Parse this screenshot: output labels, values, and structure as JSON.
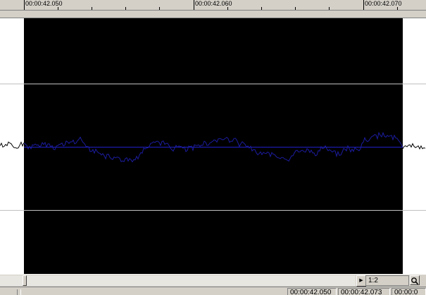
{
  "ruler": {
    "labels": [
      "00:00:42.050",
      "00:00:42.060",
      "00:00:42.070"
    ]
  },
  "zoom": {
    "value": "1:2"
  },
  "status": {
    "selection_start": "00:00:42.050",
    "selection_end": "00:00:42.073",
    "selection_length": "00:00:0"
  },
  "colors": {
    "selection_bg": "#000000",
    "waveform": "#1c1ca0",
    "unselected_wave": "#000000",
    "centerline": "#2020c8",
    "gridline": "#c0c0c0"
  },
  "icons": {
    "scroll_right": "triangle-right-icon",
    "zoom": "magnifier-icon"
  }
}
